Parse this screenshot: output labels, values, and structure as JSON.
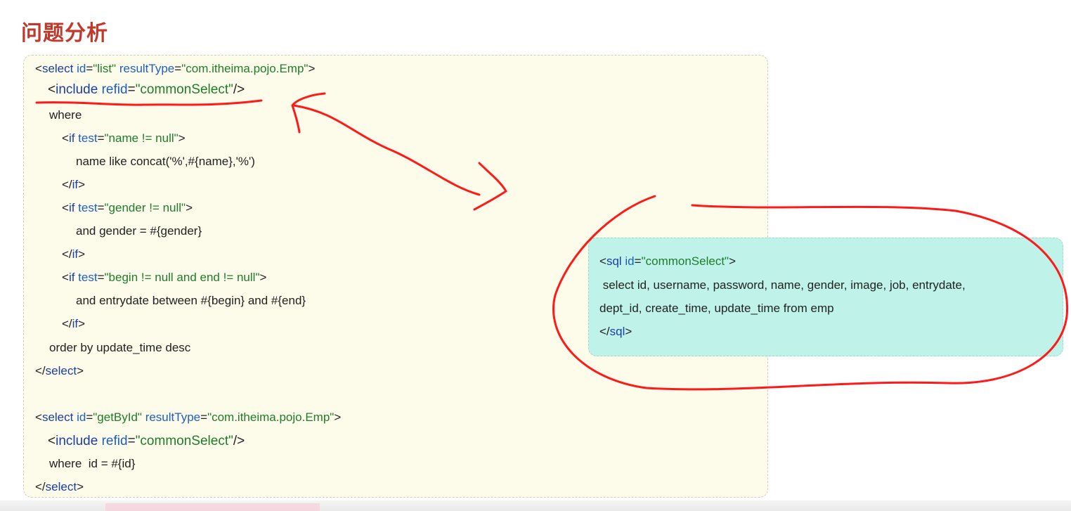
{
  "slide": {
    "title": "问题分析"
  },
  "code_block": {
    "lines": [
      {
        "tokens": [
          [
            "<",
            "punct"
          ],
          [
            "select ",
            "tag"
          ],
          [
            "id",
            "attr"
          ],
          [
            "=",
            "punct"
          ],
          [
            "\"list\"",
            "str"
          ],
          [
            " resultType",
            "attr"
          ],
          [
            "=",
            "punct"
          ],
          [
            "\"com.itheima.pojo.Emp\"",
            "str"
          ],
          [
            ">",
            "punct"
          ]
        ]
      },
      {
        "tokens": [
          [
            "<",
            "punct"
          ],
          [
            "include ",
            "tag"
          ],
          [
            "refid",
            "attr"
          ],
          [
            "=",
            "punct"
          ],
          [
            "\"commonSelect\"",
            "str"
          ],
          [
            "/>",
            "punct"
          ]
        ]
      },
      {
        "tokens": [
          [
            "where",
            "plain"
          ]
        ]
      },
      {
        "tokens": [
          [
            "<",
            "punct"
          ],
          [
            "if ",
            "tag"
          ],
          [
            "test",
            "attr"
          ],
          [
            "=",
            "punct"
          ],
          [
            "\"name != null\"",
            "str"
          ],
          [
            ">",
            "punct"
          ]
        ]
      },
      {
        "tokens": [
          [
            "name like concat('%',#{name},'%')",
            "plain"
          ]
        ]
      },
      {
        "tokens": [
          [
            "</",
            "punct"
          ],
          [
            "if",
            "tag"
          ],
          [
            ">",
            "punct"
          ]
        ]
      },
      {
        "tokens": [
          [
            "<",
            "punct"
          ],
          [
            "if ",
            "tag"
          ],
          [
            "test",
            "attr"
          ],
          [
            "=",
            "punct"
          ],
          [
            "\"gender != null\"",
            "str"
          ],
          [
            ">",
            "punct"
          ]
        ]
      },
      {
        "tokens": [
          [
            "and gender = #{gender}",
            "plain"
          ]
        ]
      },
      {
        "tokens": [
          [
            "</",
            "punct"
          ],
          [
            "if",
            "tag"
          ],
          [
            ">",
            "punct"
          ]
        ]
      },
      {
        "tokens": [
          [
            "<",
            "punct"
          ],
          [
            "if ",
            "tag"
          ],
          [
            "test",
            "attr"
          ],
          [
            "=",
            "punct"
          ],
          [
            "\"begin != null and end != null\"",
            "str"
          ],
          [
            ">",
            "punct"
          ]
        ]
      },
      {
        "tokens": [
          [
            "and entrydate between #{begin} and #{end}",
            "plain"
          ]
        ]
      },
      {
        "tokens": [
          [
            "</",
            "punct"
          ],
          [
            "if",
            "tag"
          ],
          [
            ">",
            "punct"
          ]
        ]
      },
      {
        "tokens": [
          [
            "order by update_time desc",
            "plain"
          ]
        ]
      },
      {
        "tokens": [
          [
            "</",
            "punct"
          ],
          [
            "select",
            "tag"
          ],
          [
            ">",
            "punct"
          ]
        ]
      },
      {
        "tokens": [
          [
            "<",
            "punct"
          ],
          [
            "select ",
            "tag"
          ],
          [
            "id",
            "attr"
          ],
          [
            "=",
            "punct"
          ],
          [
            "\"getById\"",
            "str"
          ],
          [
            " resultType",
            "attr"
          ],
          [
            "=",
            "punct"
          ],
          [
            "\"com.itheima.pojo.Emp\"",
            "str"
          ],
          [
            ">",
            "punct"
          ]
        ]
      },
      {
        "tokens": [
          [
            "<",
            "punct"
          ],
          [
            "include ",
            "tag"
          ],
          [
            "refid",
            "attr"
          ],
          [
            "=",
            "punct"
          ],
          [
            "\"commonSelect\"",
            "str"
          ],
          [
            "/>",
            "punct"
          ]
        ]
      },
      {
        "tokens": [
          [
            "where  id = #{id}",
            "plain"
          ]
        ]
      },
      {
        "tokens": [
          [
            "</",
            "punct"
          ],
          [
            "select",
            "tag"
          ],
          [
            ">",
            "punct"
          ]
        ]
      }
    ]
  },
  "sql_fragment": {
    "lines": [
      {
        "tokens": [
          [
            "<",
            "punct"
          ],
          [
            "sql ",
            "tag"
          ],
          [
            "id",
            "attr"
          ],
          [
            "=",
            "punct"
          ],
          [
            "\"commonSelect\"",
            "str"
          ],
          [
            ">",
            "punct"
          ]
        ]
      },
      {
        "tokens": [
          [
            " select id, username, password, name, gender, image, job, entrydate,",
            "plain"
          ]
        ]
      },
      {
        "tokens": [
          [
            "dept_id, create_time, update_time from emp",
            "plain"
          ]
        ]
      },
      {
        "tokens": [
          [
            "</",
            "punct"
          ],
          [
            "sql",
            "tag"
          ],
          [
            ">",
            "punct"
          ]
        ]
      }
    ]
  },
  "colors": {
    "title": "#c0392b",
    "tag": "#1a3ea8",
    "attribute": "#1f5fbf",
    "string": "#1e7d2a",
    "code_background": "#fdfbea",
    "sql_background": "#bff3ea",
    "annotation_ink": "#ff1a1a"
  }
}
